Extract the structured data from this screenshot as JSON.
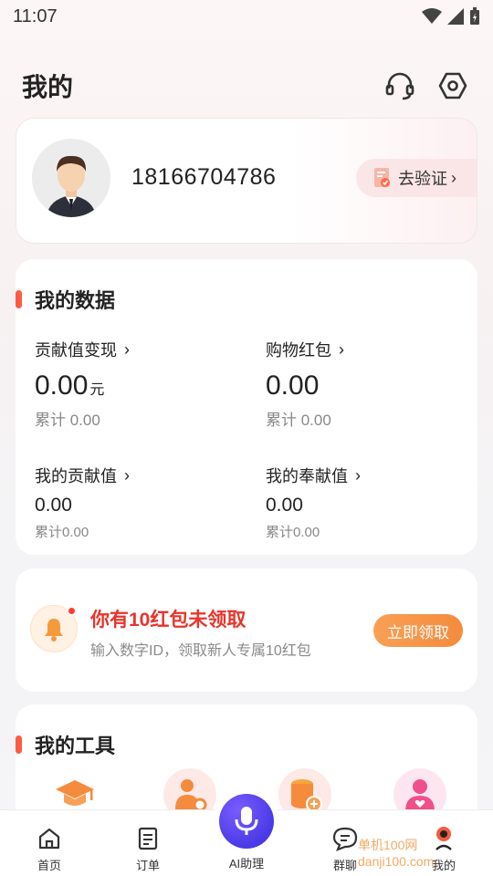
{
  "status_bar": {
    "time": "11:07"
  },
  "header": {
    "title": "我的",
    "icons": [
      "headset-icon",
      "settings-hex-icon"
    ]
  },
  "profile": {
    "phone": "18166704786",
    "verify_label": "去验证",
    "verify_chevron": "›"
  },
  "my_data": {
    "title": "我的数据",
    "stats": [
      {
        "label": "贡献值变现",
        "chevron": "›",
        "value": "0.00",
        "unit": "元",
        "total": "累计 0.00"
      },
      {
        "label": "购物红包",
        "chevron": "›",
        "value": "0.00",
        "unit": "",
        "total": "累计 0.00"
      },
      {
        "label": "我的贡献值",
        "chevron": "›",
        "value": "0.00",
        "total": "累计0.00"
      },
      {
        "label": "我的奉献值",
        "chevron": "›",
        "value": "0.00",
        "total": "累计0.00"
      }
    ]
  },
  "red_packet": {
    "title": "你有10红包未领取",
    "subtitle": "输入数字ID，领取新人专属10红包",
    "button": "立即领取"
  },
  "tools": {
    "title": "我的工具",
    "icons": [
      "graduation-cap-icon",
      "user-settings-icon",
      "coins-icon",
      "user-heart-icon"
    ]
  },
  "bottom_nav": {
    "items": [
      {
        "label": "首页",
        "icon": "home-icon"
      },
      {
        "label": "订单",
        "icon": "order-icon"
      },
      {
        "label": "AI助理",
        "icon": "microphone-icon"
      },
      {
        "label": "群聊",
        "icon": "chat-icon"
      },
      {
        "label": "我的",
        "icon": "profile-icon"
      }
    ]
  },
  "watermark": {
    "text": "单机100网 danji100.com"
  },
  "colors": {
    "accent_red": "#e8342b",
    "section_bar": "#ff5a44",
    "button_orange": "#f58b3d",
    "ai_purple": "#4a3ae6"
  }
}
